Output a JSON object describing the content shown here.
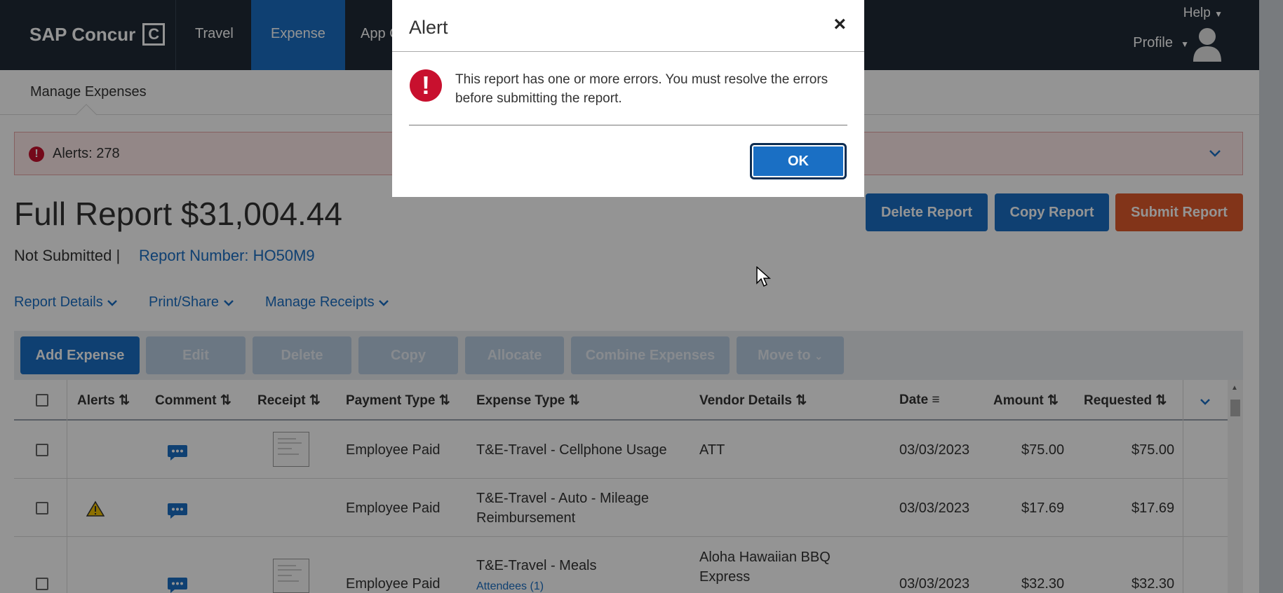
{
  "nav": {
    "logo": "SAP Concur",
    "logo_mark": "C",
    "items": [
      {
        "label": "Travel"
      },
      {
        "label": "Expense"
      },
      {
        "label": "App C"
      }
    ],
    "help": "Help",
    "profile": "Profile"
  },
  "subnav": {
    "manage_expenses": "Manage Expenses"
  },
  "alertbar": {
    "text": "Alerts: 278"
  },
  "report": {
    "title": "Full Report $31,004.44",
    "status": "Not Submitted |",
    "number": "Report Number: HO50M9"
  },
  "actions": {
    "delete": "Delete Report",
    "copy": "Copy Report",
    "submit": "Submit Report"
  },
  "links": {
    "details": "Report Details",
    "print": "Print/Share",
    "receipts": "Manage Receipts"
  },
  "toolbar": {
    "add": "Add Expense",
    "edit": "Edit",
    "delete": "Delete",
    "copy": "Copy",
    "allocate": "Allocate",
    "combine": "Combine Expenses",
    "move": "Move to"
  },
  "table": {
    "headers": {
      "alerts": "Alerts",
      "comment": "Comment",
      "receipt": "Receipt",
      "payment": "Payment Type",
      "expense": "Expense Type",
      "vendor": "Vendor Details",
      "date": "Date",
      "amount": "Amount",
      "requested": "Requested"
    },
    "rows": [
      {
        "payment": "Employee Paid",
        "expense": "T&E-Travel - Cellphone Usage",
        "expense2": "",
        "vendor": "ATT",
        "vendor2": "",
        "date": "03/03/2023",
        "amount": "$75.00",
        "requested": "$75.00",
        "attendees": ""
      },
      {
        "payment": "Employee Paid",
        "expense": "T&E-Travel - Auto - Mileage",
        "expense2": "Reimbursement",
        "vendor": "",
        "vendor2": "",
        "date": "03/03/2023",
        "amount": "$17.69",
        "requested": "$17.69",
        "attendees": ""
      },
      {
        "payment": "Employee Paid",
        "expense": "T&E-Travel - Meals",
        "expense2": "",
        "vendor": "Aloha Hawaiian BBQ",
        "vendor2": "Express",
        "date": "03/03/2023",
        "amount": "$32.30",
        "requested": "$32.30",
        "attendees": "Attendees (1)"
      }
    ]
  },
  "modal": {
    "title": "Alert",
    "close": "×",
    "message": "This report has one or more errors. You must resolve the errors before submitting the report.",
    "ok": "OK"
  },
  "colors": {
    "nav_bg": "#1f2a36",
    "accent": "#1a6fc4",
    "submit": "#e05a2b",
    "error": "#c8102e"
  }
}
